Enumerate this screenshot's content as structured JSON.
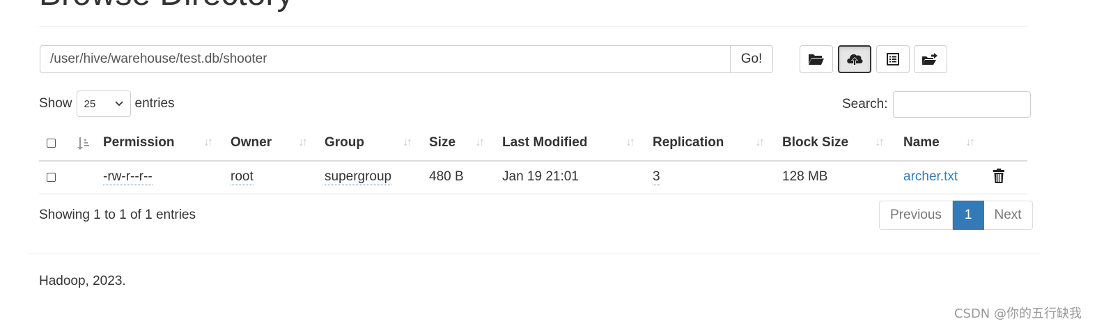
{
  "page_title": "Browse Directory",
  "path_bar": {
    "value": "/user/hive/warehouse/test.db/shooter",
    "go_label": "Go!"
  },
  "toolbar": {
    "buttons": [
      {
        "icon": "folder-open-icon"
      },
      {
        "icon": "cloud-upload-icon",
        "active": true
      },
      {
        "icon": "list-alt-icon"
      },
      {
        "icon": "folder-move-icon"
      }
    ]
  },
  "length_control": {
    "prefix": "Show",
    "selected": "25",
    "suffix": "entries"
  },
  "search": {
    "label": "Search:",
    "value": ""
  },
  "table": {
    "columns": [
      "Permission",
      "Owner",
      "Group",
      "Size",
      "Last Modified",
      "Replication",
      "Block Size",
      "Name"
    ],
    "rows": [
      {
        "permission": "-rw-r--r--",
        "owner": "root",
        "group": "supergroup",
        "size": "480 B",
        "last_modified": "Jan 19 21:01",
        "replication": "3",
        "block_size": "128 MB",
        "name": "archer.txt"
      }
    ]
  },
  "info": "Showing 1 to 1 of 1 entries",
  "pagination": {
    "previous": "Previous",
    "current": "1",
    "next": "Next"
  },
  "footer": "Hadoop, 2023.",
  "watermark": "CSDN @你的五行缺我",
  "colors": {
    "link": "#337ab7",
    "active_page": "#337ab7"
  }
}
